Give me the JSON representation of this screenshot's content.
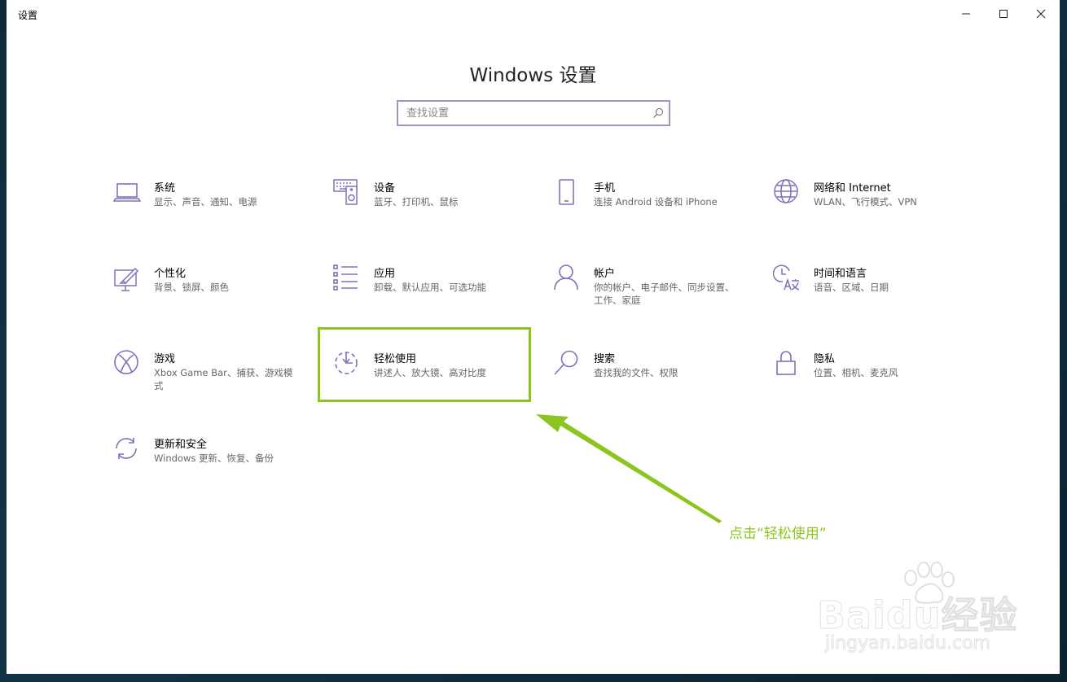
{
  "window": {
    "title": "设置"
  },
  "page": {
    "title": "Windows 设置"
  },
  "search": {
    "placeholder": "查找设置",
    "value": ""
  },
  "tiles": [
    {
      "icon": "laptop-icon",
      "title": "系统",
      "desc": "显示、声音、通知、电源"
    },
    {
      "icon": "devices-icon",
      "title": "设备",
      "desc": "蓝牙、打印机、鼠标"
    },
    {
      "icon": "phone-icon",
      "title": "手机",
      "desc": "连接 Android 设备和 iPhone"
    },
    {
      "icon": "globe-icon",
      "title": "网络和 Internet",
      "desc": "WLAN、飞行模式、VPN"
    },
    {
      "icon": "personalization-icon",
      "title": "个性化",
      "desc": "背景、锁屏、颜色"
    },
    {
      "icon": "apps-list-icon",
      "title": "应用",
      "desc": "卸载、默认应用、可选功能"
    },
    {
      "icon": "person-icon",
      "title": "帐户",
      "desc": "你的帐户、电子邮件、同步设置、工作、家庭"
    },
    {
      "icon": "time-language-icon",
      "title": "时间和语言",
      "desc": "语音、区域、日期"
    },
    {
      "icon": "xbox-icon",
      "title": "游戏",
      "desc": "Xbox Game Bar、捕获、游戏模式"
    },
    {
      "icon": "ease-of-access-icon",
      "title": "轻松使用",
      "desc": "讲述人、放大镜、高对比度"
    },
    {
      "icon": "search-icon",
      "title": "搜索",
      "desc": "查找我的文件、权限"
    },
    {
      "icon": "lock-icon",
      "title": "隐私",
      "desc": "位置、相机、麦克风"
    },
    {
      "icon": "update-sync-icon",
      "title": "更新和安全",
      "desc": "Windows 更新、恢复、备份"
    }
  ],
  "annotation": {
    "text": "点击“轻松使用”",
    "color": "#8cc420"
  },
  "watermark": {
    "logo": "Baidu经验",
    "url": "jingyan.baidu.com"
  },
  "colors": {
    "icon_accent": "#7b73b8",
    "highlight": "#8cc420"
  }
}
